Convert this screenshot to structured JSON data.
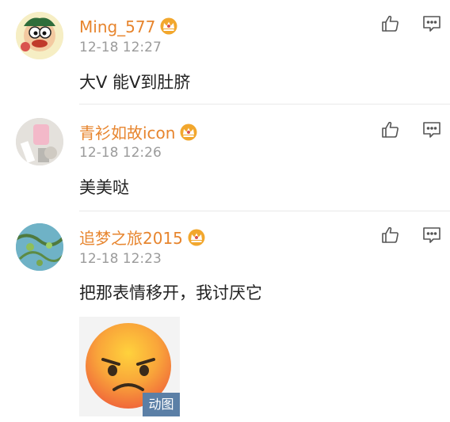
{
  "comments": [
    {
      "username": "Ming_577",
      "time": "12-18 12:27",
      "text": "大V 能V到肚脐"
    },
    {
      "username": "青衫如故icon",
      "time": "12-18 12:26",
      "text": "美美哒"
    },
    {
      "username": "追梦之旅2015",
      "time": "12-18 12:23",
      "text": "把那表情移开，我讨厌它"
    }
  ],
  "attachment": {
    "badge": "动图"
  },
  "icons": {
    "like": "thumbs-up-icon",
    "reply": "comment-icon",
    "vip": "crown-icon"
  },
  "colors": {
    "username": "#e7852e",
    "time": "#9b9b9b",
    "text": "#222222",
    "badge_bg": "#5b7fa6",
    "crown": "#f2a72d"
  }
}
